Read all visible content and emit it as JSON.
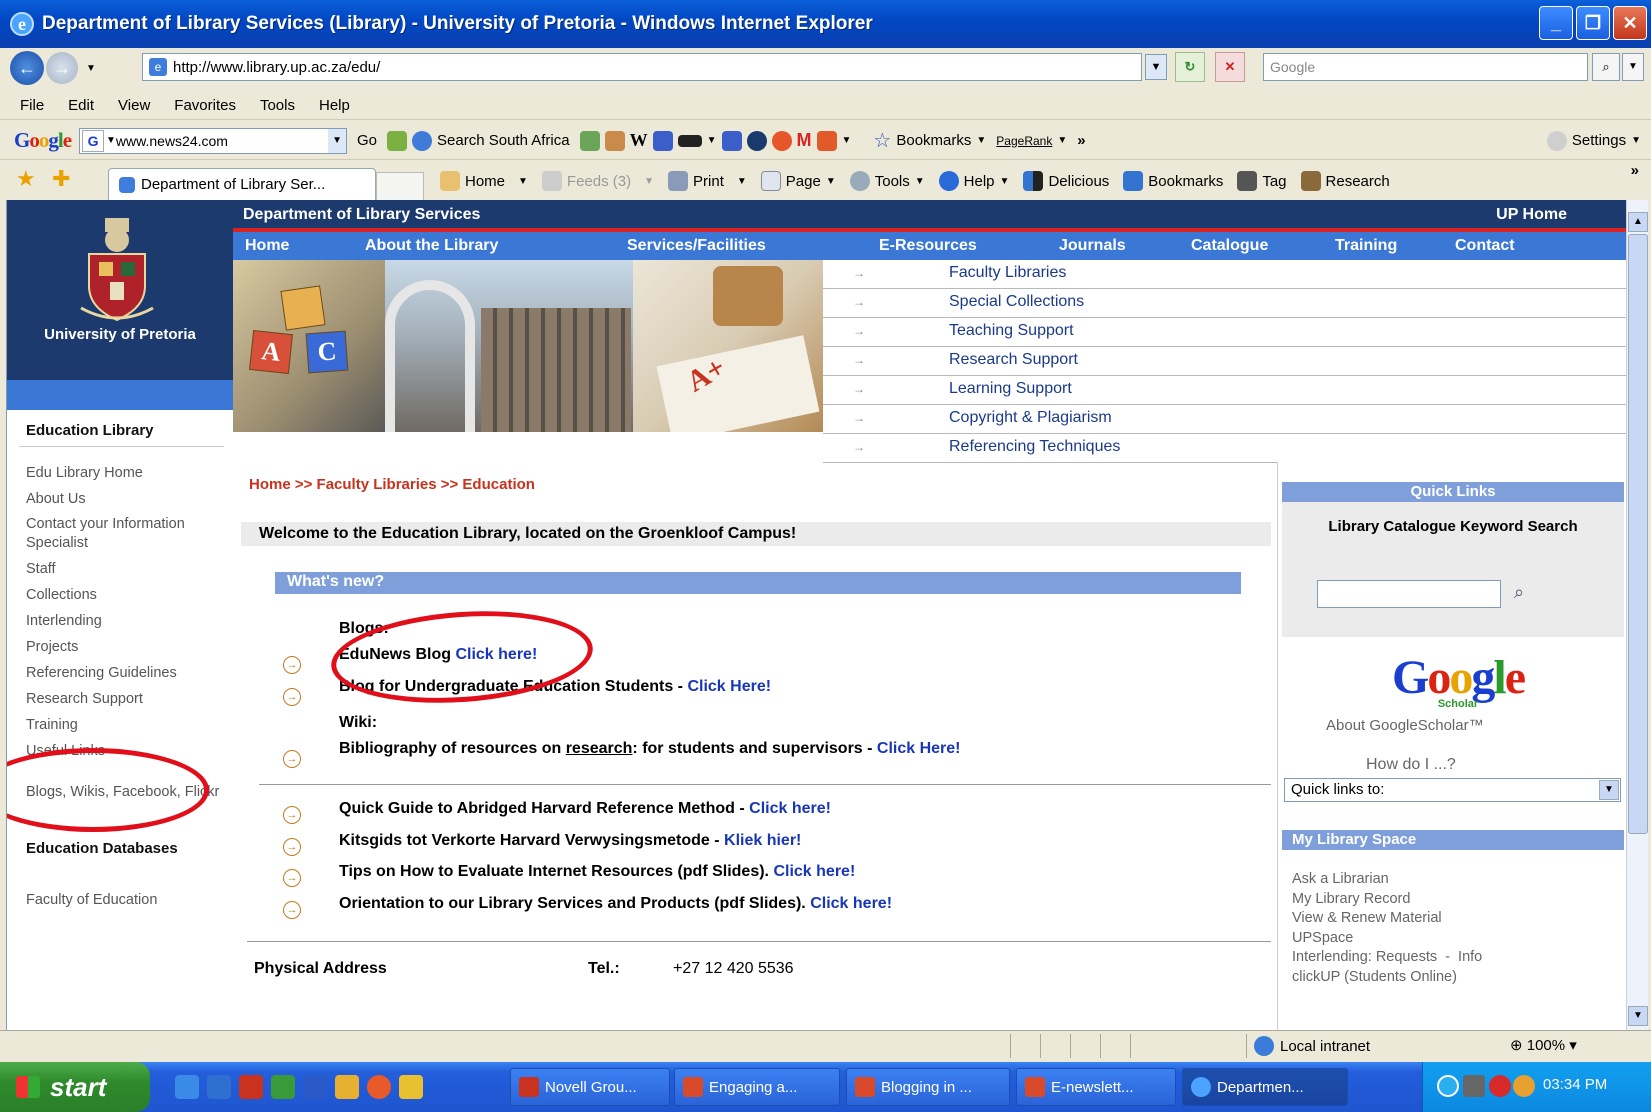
{
  "window": {
    "title": "Department of Library Services (Library) - University of Pretoria - Windows Internet Explorer",
    "minimize": "_",
    "restore": "❐",
    "close": "✕"
  },
  "address": {
    "url": "http://www.library.up.ac.za/edu/",
    "search_placeholder": "Google"
  },
  "menu": [
    "File",
    "Edit",
    "View",
    "Favorites",
    "Tools",
    "Help"
  ],
  "google_toolbar": {
    "box_value": "www.news24.com",
    "go": "Go",
    "search_sa": "Search South Africa",
    "bookmarks": "Bookmarks",
    "pagerank": "PageRank",
    "more": "»",
    "settings": "Settings"
  },
  "favbar": {
    "tab_title": "Department of Library Ser...",
    "home": "Home",
    "feeds": "Feeds (3)",
    "print": "Print",
    "page": "Page",
    "tools": "Tools",
    "help": "Help",
    "delicious": "Delicious",
    "bookmarks": "Bookmarks",
    "tag": "Tag",
    "research": "Research",
    "more": "»"
  },
  "site": {
    "header": "Department of Library Services",
    "up_home": "UP Home",
    "university": "University of Pretoria",
    "topnav": [
      "Home",
      "About the Library",
      "Services/Facilities",
      "E-Resources",
      "Journals",
      "Catalogue",
      "Training",
      "Contact"
    ],
    "submenu": [
      "Faculty Libraries",
      "Special Collections",
      "Teaching Support",
      "Research Support",
      "Learning Support",
      "Copyright & Plagiarism",
      "Referencing Techniques"
    ],
    "submenu_arrow": "→"
  },
  "left": {
    "title": "Education Library",
    "links": [
      "Edu Library Home",
      "About Us",
      "Contact your Information Specialist",
      "Staff",
      "Collections",
      "Interlending",
      "Projects",
      "Referencing Guidelines",
      "Research Support",
      "Training",
      "Useful Links"
    ],
    "blogs": "Blogs, Wikis, Facebook, Flickr",
    "databases_title": "Education Databases",
    "faculty": "Faculty of Education"
  },
  "main": {
    "breadcrumb": "Home >> Faculty Libraries >> Education",
    "welcome": "Welcome to the Education Library, located on the Groenkloof Campus!",
    "whats_new": "What's new?",
    "blogs_heading": "Blogs:",
    "items": [
      {
        "text": "EduNews Blog ",
        "link": "Click here!"
      },
      {
        "text": "Blog for Undergraduate Education Students - ",
        "link": "Click Here!"
      }
    ],
    "wiki_heading": "Wiki:",
    "wiki_item": {
      "pre": "Bibliography of resources on ",
      "u": "research",
      "post": ": for students and supervisors - ",
      "link": "Click Here!"
    },
    "guides": [
      {
        "text": "Quick Guide to Abridged Harvard Reference Method - ",
        "link": "Click here!"
      },
      {
        "text": "Kitsgids tot Verkorte Harvard Verwysingsmetode - ",
        "link": "Kliek hier!"
      },
      {
        "text": "Tips on How to Evaluate Internet Resources (pdf Slides). ",
        "link": "Click here!"
      },
      {
        "text": "Orientation to our Library Services and Products (pdf Slides). ",
        "link": "Click here!"
      }
    ],
    "physical_address": "Physical Address",
    "tel_label": "Tel.:",
    "tel_value": "+27 12 420 5536"
  },
  "right": {
    "quick_links": "Quick Links",
    "catalogue_search": "Library Catalogue Keyword Search",
    "scholar_sub": "Scholar",
    "about_scholar": "About GoogleScholar™",
    "how_do_i": "How do I ...?",
    "quick_links_select": "Quick links to:",
    "my_library_space": "My Library Space",
    "mls_links": [
      "Ask a Librarian",
      "My Library Record",
      "View & Renew Material",
      "UPSpace",
      "Interlending: Requests  -  Info",
      "clickUP (Students Online)"
    ]
  },
  "status": {
    "zone": "Local intranet",
    "zoom": "100%"
  },
  "taskbar": {
    "start": "start",
    "tasks": [
      "Novell Grou...",
      "Engaging a...",
      "Blogging in ...",
      "E-newslett...",
      "Departmen..."
    ],
    "clock": "03:34 PM"
  }
}
